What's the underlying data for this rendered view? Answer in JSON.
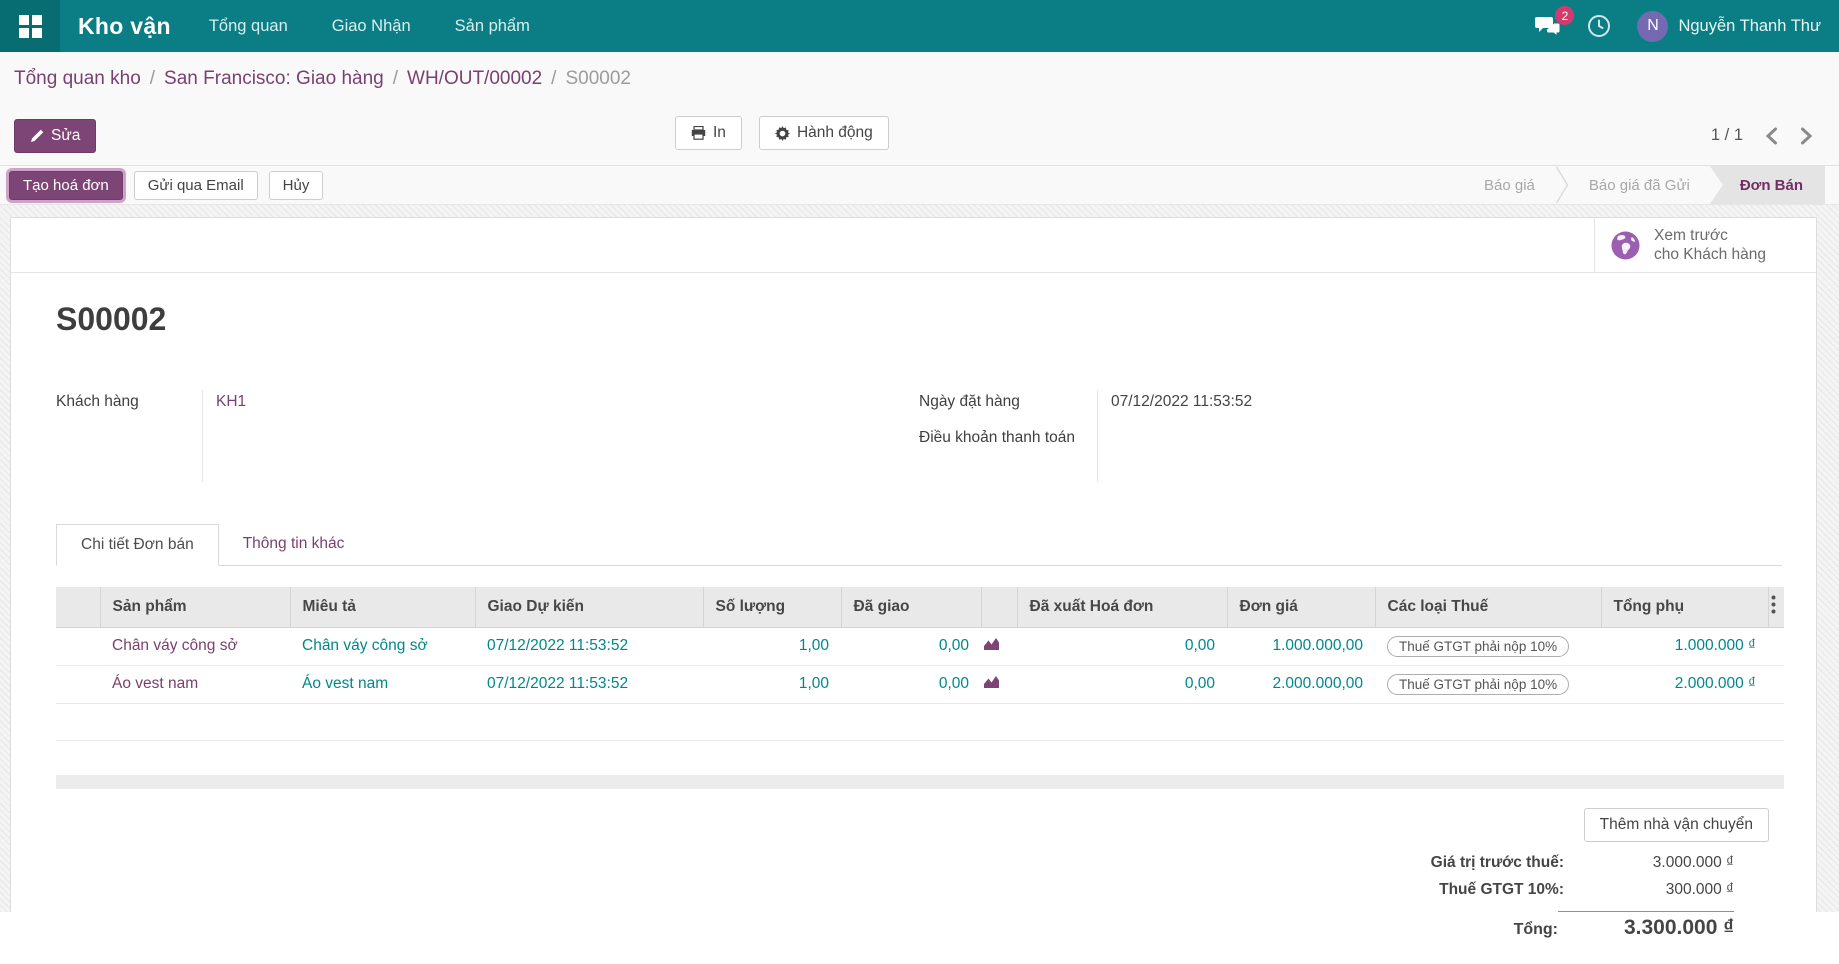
{
  "colors": {
    "nav_teal": "#0a7e84",
    "primary_purple": "#7c4576",
    "link_purple": "#7a3f6e",
    "field_teal": "#00878c",
    "badge_pink": "#d23c6c",
    "avatar_purple": "#7569b2"
  },
  "icons": {
    "apps": "grid-icon",
    "messages": "chat-bubbles-icon",
    "activity": "clock-icon",
    "edit": "pencil-icon",
    "print": "printer-icon",
    "action": "gear-icon",
    "pager_prev": "chevron-left-icon",
    "pager_next": "chevron-right-icon",
    "preview": "globe-icon",
    "forecast": "area-chart-icon",
    "options": "kebab-dots-icon"
  },
  "nav": {
    "brand": "Kho vận",
    "menus": [
      "Tổng quan",
      "Giao Nhận",
      "Sản phẩm"
    ],
    "badge_count": "2",
    "user_initial": "N",
    "user_name": "Nguyễn Thanh Thư"
  },
  "breadcrumb": {
    "items": [
      "Tổng quan kho",
      "San Francisco: Giao hàng",
      "WH/OUT/00002"
    ],
    "separator": "/",
    "current": "S00002"
  },
  "control": {
    "edit": "Sửa",
    "print": "In",
    "action": "Hành động",
    "pager": "1 / 1"
  },
  "statusbar": {
    "invoice": "Tạo hoá đơn",
    "email": "Gửi qua Email",
    "cancel": "Hủy",
    "states": [
      {
        "label": "Báo giá"
      },
      {
        "label": "Báo giá đã Gửi"
      },
      {
        "label": "Đơn Bán"
      }
    ]
  },
  "preview": {
    "line1": "Xem trước",
    "line2": "cho Khách hàng"
  },
  "doc": {
    "title": "S00002",
    "fields": {
      "customer_label": "Khách hàng",
      "customer_value": "KH1",
      "order_date_label": "Ngày đặt hàng",
      "order_date_value": "07/12/2022 11:53:52",
      "payment_terms_label": "Điều khoản thanh toán"
    },
    "tabs": [
      {
        "label": "Chi tiết Đơn bán"
      },
      {
        "label": "Thông tin khác"
      }
    ],
    "table": {
      "headers": [
        "Sản phẩm",
        "Miêu tả",
        "Giao Dự kiến",
        "Số lượng",
        "Đã giao",
        "Đã xuất Hoá đơn",
        "Đơn giá",
        "Các loại Thuế",
        "Tổng phụ"
      ],
      "rows": [
        {
          "product": "Chân váy công sở",
          "description": "Chân váy công sở",
          "delivery": "07/12/2022 11:53:52",
          "qty": "1,00",
          "delivered": "0,00",
          "invoiced": "0,00",
          "unit_price": "1.000.000,00",
          "taxes": "Thuế GTGT phải nộp 10%",
          "subtotal": "1.000.000 ₫"
        },
        {
          "product": "Áo vest nam",
          "description": "Áo vest nam",
          "delivery": "07/12/2022 11:53:52",
          "qty": "1,00",
          "delivered": "0,00",
          "invoiced": "0,00",
          "unit_price": "2.000.000,00",
          "taxes": "Thuế GTGT phải nộp 10%",
          "subtotal": "2.000.000 ₫"
        }
      ]
    },
    "totals": {
      "add_shipping": "Thêm nhà vận chuyển",
      "untaxed_label": "Giá trị trước thuế:",
      "untaxed_value": "3.000.000 ₫",
      "tax_label": "Thuế GTGT 10%:",
      "tax_value": "300.000 ₫",
      "total_label": "Tổng:",
      "total_value": "3.300.000 ₫"
    }
  }
}
